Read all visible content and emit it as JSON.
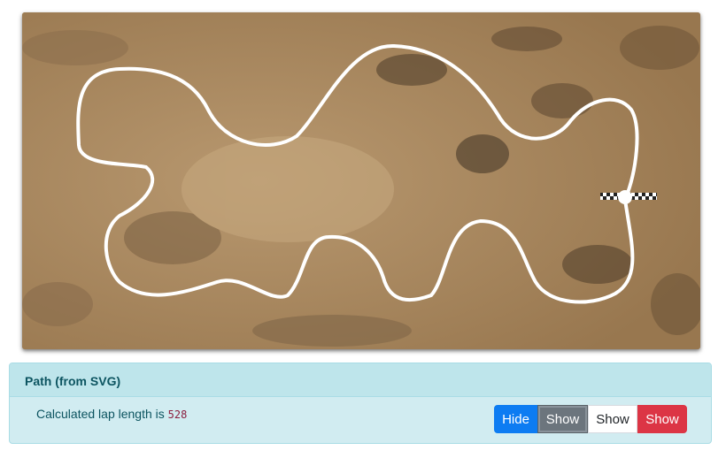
{
  "panel": {
    "title": "Path (from SVG)",
    "lap_text": "Calculated lap length is",
    "lap_value": "528"
  },
  "buttons": {
    "hide_label": "Hide",
    "show_dark_label": "Show",
    "show_light_label": "Show",
    "show_red_label": "Show"
  },
  "colors": {
    "panel_bg": "#d1ecf1",
    "panel_header_bg": "#bee5eb",
    "panel_text": "#0c5460",
    "primary": "#0d7cf2",
    "secondary": "#6c757d",
    "danger": "#dc3545",
    "track": "#ffffff"
  },
  "icons": {
    "start_finish": "checkered-start-line-icon"
  }
}
